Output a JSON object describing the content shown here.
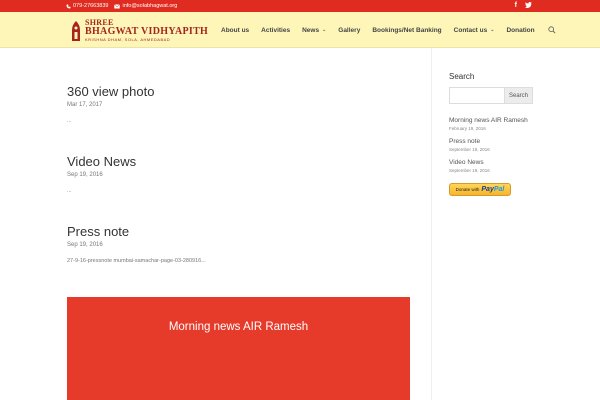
{
  "topbar": {
    "phone": "079-27663839",
    "email": "info@solabhagwat.org",
    "social": [
      "facebook-icon",
      "twitter-icon"
    ],
    "colors": {
      "background": "#e02b20"
    }
  },
  "logo": {
    "line1": "SHREE",
    "line2": "BHAGWAT VIDHYAPITH",
    "line3": "KRISHNA DHAM, SOLA, AHMEDABAD"
  },
  "nav": {
    "items": [
      {
        "label": "About us",
        "dropdown": false
      },
      {
        "label": "Activities",
        "dropdown": false
      },
      {
        "label": "News",
        "dropdown": true
      },
      {
        "label": "Gallery",
        "dropdown": false
      },
      {
        "label": "Bookings/Net Banking",
        "dropdown": false
      },
      {
        "label": "Contact us",
        "dropdown": true
      },
      {
        "label": "Donation",
        "dropdown": false
      }
    ]
  },
  "posts": [
    {
      "title": "360 view photo",
      "date": "Mar 17, 2017",
      "excerpt": "..."
    },
    {
      "title": "Video News",
      "date": "Sep 19, 2016",
      "excerpt": "..."
    },
    {
      "title": "Press note",
      "date": "Sep 19, 2016",
      "excerpt": "27-9-16-pressnote mumbai-samachar-page-03-280916..."
    }
  ],
  "banner": {
    "title": "Morning news AIR Ramesh",
    "color": "#e63a2a"
  },
  "sidebar": {
    "search_title": "Search",
    "search_placeholder": "",
    "search_button": "Search",
    "recent": [
      {
        "title": "Morning news AIR Ramesh",
        "date": "February 19, 2016"
      },
      {
        "title": "Press note",
        "date": "September 19, 2016"
      },
      {
        "title": "Video News",
        "date": "September 19, 2016"
      }
    ],
    "paypal": {
      "pre": "Donate with",
      "brand1": "Pay",
      "brand2": "Pal"
    }
  }
}
